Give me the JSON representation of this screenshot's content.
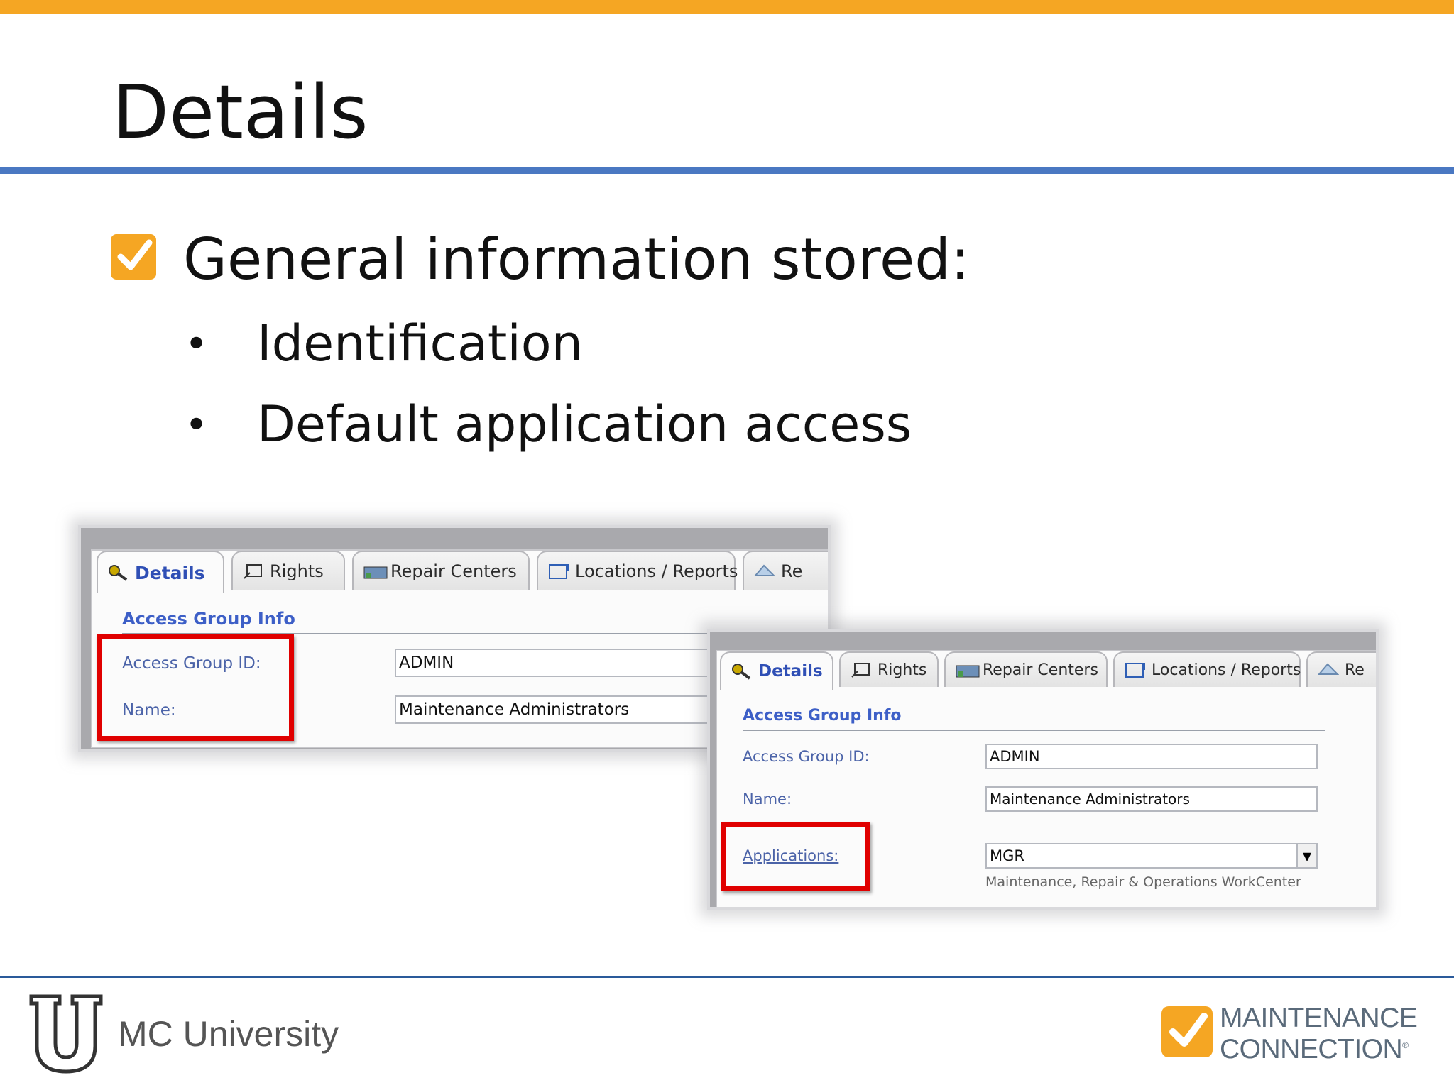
{
  "slide": {
    "title": "Details",
    "bullet_main": "General information stored:",
    "sub_bullets": [
      "Identification",
      "Default application access"
    ],
    "bullet_symbol": "•"
  },
  "panel_back": {
    "tabs": [
      "Details",
      "Rights",
      "Repair Centers",
      "Locations / Reports",
      "Re"
    ],
    "section_title": "Access Group Info",
    "fields": [
      {
        "label": "Access Group ID:",
        "value": "ADMIN"
      },
      {
        "label": "Name:",
        "value": "Maintenance Administrators"
      }
    ]
  },
  "panel_front": {
    "tabs": [
      "Details",
      "Rights",
      "Repair Centers",
      "Locations / Reports",
      "Re"
    ],
    "section_title": "Access Group Info",
    "fields": [
      {
        "label": "Access Group ID:",
        "value": "ADMIN"
      },
      {
        "label": "Name:",
        "value": "Maintenance Administrators"
      },
      {
        "label": "Applications:",
        "value": "MGR"
      }
    ],
    "applications_hint": "Maintenance, Repair & Operations WorkCenter"
  },
  "footer": {
    "left_text": "MC University",
    "brand_line1": "MAINTENANCE",
    "brand_line2": "CONNECTION",
    "brand_mark": "®"
  },
  "colors": {
    "accent_orange": "#f5a623",
    "rule_blue": "#4a78c2",
    "highlight_red": "#e00000",
    "label_blue": "#4b63a8"
  },
  "icons": [
    "checkbox-checked-icon",
    "key-icon",
    "rights-icon",
    "repair-centers-icon",
    "locations-icon",
    "reports-icon",
    "dropdown-arrow-icon",
    "mc-university-logo",
    "maintenance-connection-logo"
  ]
}
